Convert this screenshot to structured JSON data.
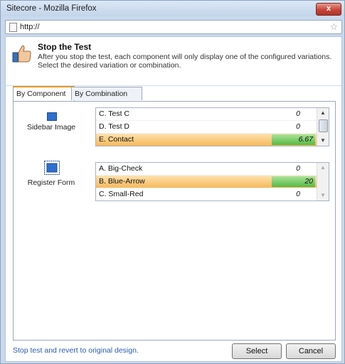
{
  "window": {
    "title": "Sitecore - Mozilla Firefox",
    "close_symbol": "x"
  },
  "address_bar": {
    "url": "http://"
  },
  "header": {
    "title": "Stop the Test",
    "description": "After you stop the test, each component will only display one of the configured variations. Select the desired variation or combination."
  },
  "tabs": [
    {
      "label": "By Component",
      "active": true
    },
    {
      "label": "By Combination",
      "active": false
    }
  ],
  "components": [
    {
      "label": "Sidebar Image",
      "variations": [
        {
          "name": "C. Test C",
          "value": "0",
          "selected": false
        },
        {
          "name": "D. Test D",
          "value": "0",
          "selected": false
        },
        {
          "name": "E. Contact",
          "value": "6.67",
          "selected": true
        }
      ]
    },
    {
      "label": "Register Form",
      "variations": [
        {
          "name": "A. Big-Check",
          "value": "0",
          "selected": false
        },
        {
          "name": "B. Blue-Arrow",
          "value": "20",
          "selected": true
        },
        {
          "name": "C. Small-Red",
          "value": "0",
          "selected": false
        }
      ]
    }
  ],
  "footer": {
    "revert_link": "Stop test and revert to original design.",
    "select_label": "Select",
    "cancel_label": "Cancel"
  },
  "colors": {
    "selected_row": "#f7b85a",
    "value_bar": "#56b943",
    "link": "#2a5db0"
  }
}
